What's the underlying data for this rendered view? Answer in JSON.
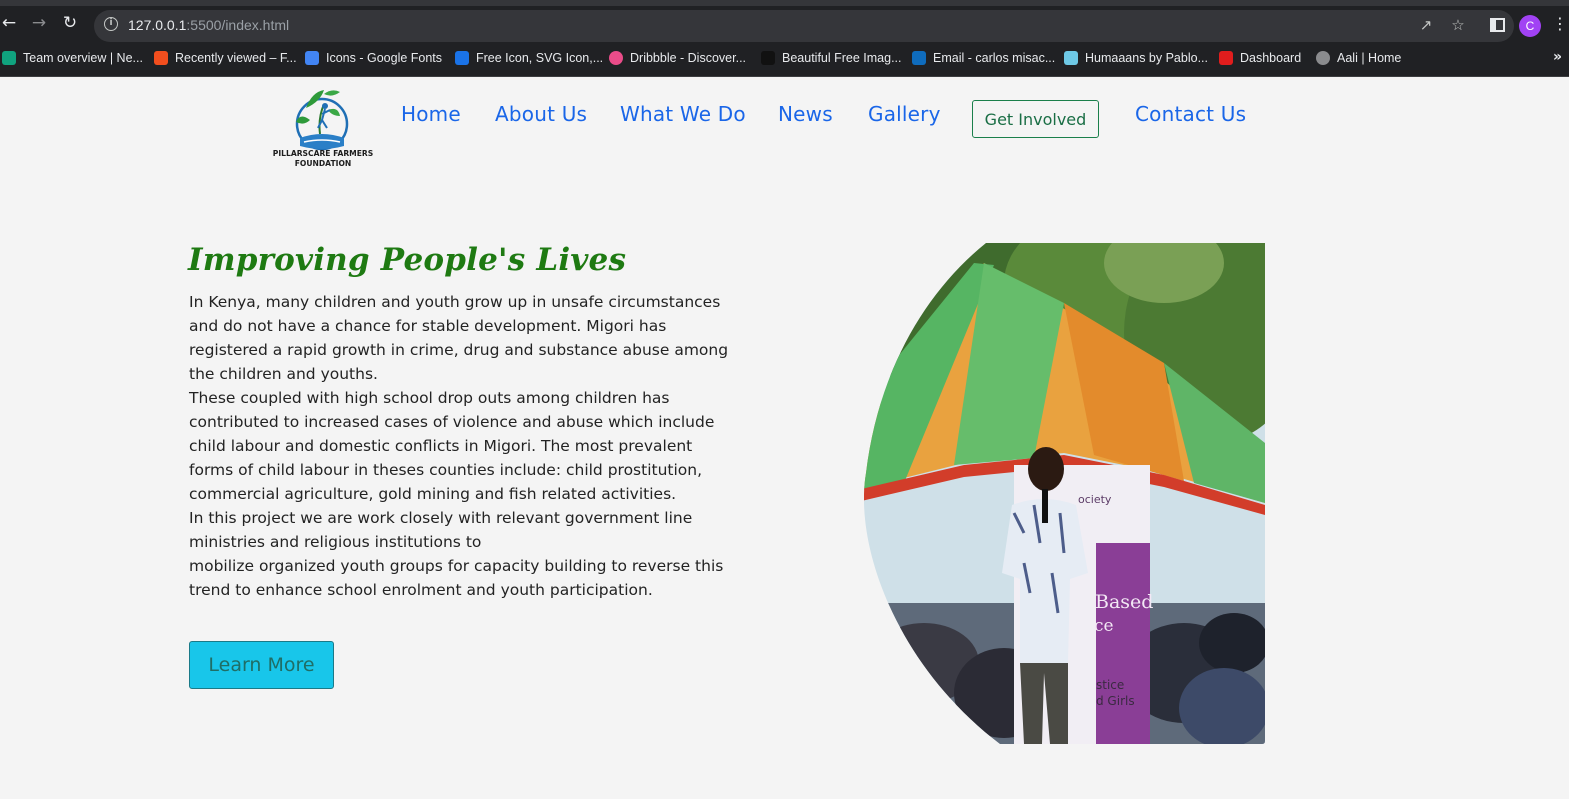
{
  "browser": {
    "url_host": "127.0.0.1",
    "url_path": ":5500/index.html",
    "profile_initial": "C",
    "bookmarks": [
      {
        "label": "Team overview | Ne...",
        "icon": "teal-diamond-icon",
        "color": "#10a37f"
      },
      {
        "label": "Recently viewed – F...",
        "icon": "figma-icon",
        "color": "#f24e1e"
      },
      {
        "label": "Icons - Google Fonts",
        "icon": "google-fonts-icon",
        "color": "#4285f4"
      },
      {
        "label": "Free Icon, SVG Icon,...",
        "icon": "flaticon-icon",
        "color": "#1a73e8"
      },
      {
        "label": "Dribbble - Discover...",
        "icon": "dribbble-icon",
        "color": "#ea4c89"
      },
      {
        "label": "Beautiful Free Imag...",
        "icon": "unsplash-icon",
        "color": "#111111"
      },
      {
        "label": "Email - carlos misac...",
        "icon": "outlook-icon",
        "color": "#0f6cbd"
      },
      {
        "label": "Humaaans by Pablo...",
        "icon": "humaaans-icon",
        "color": "#6ec9e6"
      },
      {
        "label": "Dashboard",
        "icon": "e-icon",
        "color": "#e11d1d"
      },
      {
        "label": "Aali | Home",
        "icon": "globe-icon",
        "color": "#8a8b8e"
      }
    ]
  },
  "site": {
    "logo_text": "PILLARSCARE FARMERS FOUNDATION",
    "nav": {
      "home": "Home",
      "about": "About Us",
      "what_we_do": "What We Do",
      "news": "News",
      "gallery": "Gallery",
      "cta": "Get Involved",
      "contact": "Contact Us"
    }
  },
  "hero": {
    "title": "Improving People's Lives",
    "paragraphs": [
      "In Kenya, many children and youth grow up in unsafe circumstances and do not have a chance for stable development. Migori has registered a rapid growth in crime, drug and substance abuse among the children and youths.",
      "These coupled with high school drop outs among children has contributed to increased cases of violence and abuse which include child labour and domestic conflicts in Migori. The most prevalent forms of child labour in theses counties include: child prostitution, commercial agriculture, gold mining and fish related activities.",
      "In this project we are work closely with relevant government line ministries and religious institutions to",
      "mobilize organized youth groups for capacity building to reverse this trend to enhance school enrolment and youth participation."
    ],
    "button": "Learn More",
    "banner_text_1": "Based",
    "banner_text_2": "ce",
    "banner_text_3": "stice",
    "banner_text_4": "d Girls",
    "banner_text_5": "ociety"
  },
  "colors": {
    "nav_link": "#1a66e8",
    "title_green": "#1e7a12",
    "cta_border": "#1a7f4b",
    "button_bg": "#18c6ea"
  }
}
